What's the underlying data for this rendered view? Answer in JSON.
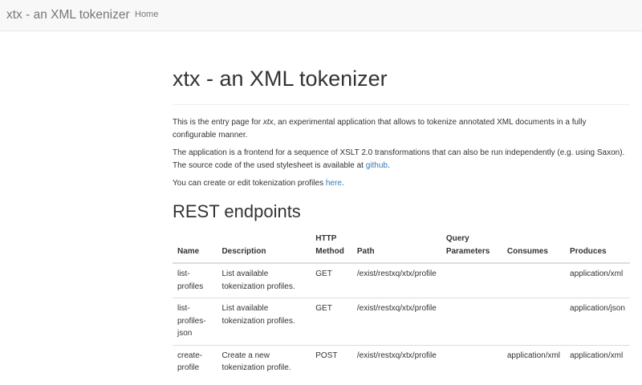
{
  "navbar": {
    "brand": "xtx - an XML tokenizer",
    "links": [
      "Home"
    ]
  },
  "page": {
    "title": "xtx - an XML tokenizer",
    "intro": {
      "before": "This is the entry page for ",
      "em": "xtx",
      "after": ", an experimental application that allows to tokenize annotated XML documents in a fully configurable manner."
    },
    "app_desc": {
      "text": "The application is a frontend for a sequence of XSLT 2.0 transformations that can also be run independently (e.g. using Saxon). The source code of the used stylesheet is available at ",
      "link": "github",
      "end": "."
    },
    "profiles": {
      "text": "You can create or edit tokenization profiles ",
      "link": "here",
      "end": "."
    },
    "endpoints_heading": "REST endpoints"
  },
  "table": {
    "headers": [
      "Name",
      "Description",
      "HTTP Method",
      "Path",
      "Query Parameters",
      "Consumes",
      "Produces"
    ],
    "rows": [
      [
        "list-profiles",
        "List available tokenization profiles.",
        "GET",
        "/exist/restxq/xtx/profile",
        "",
        "",
        "application/xml"
      ],
      [
        "list-profiles-json",
        "List available tokenization profiles.",
        "GET",
        "/exist/restxq/xtx/profile",
        "",
        "",
        "application/json"
      ],
      [
        "create-profile",
        "Create a new tokenization profile.",
        "POST",
        "/exist/restxq/xtx/profile",
        "",
        "application/xml",
        "application/xml"
      ]
    ]
  }
}
